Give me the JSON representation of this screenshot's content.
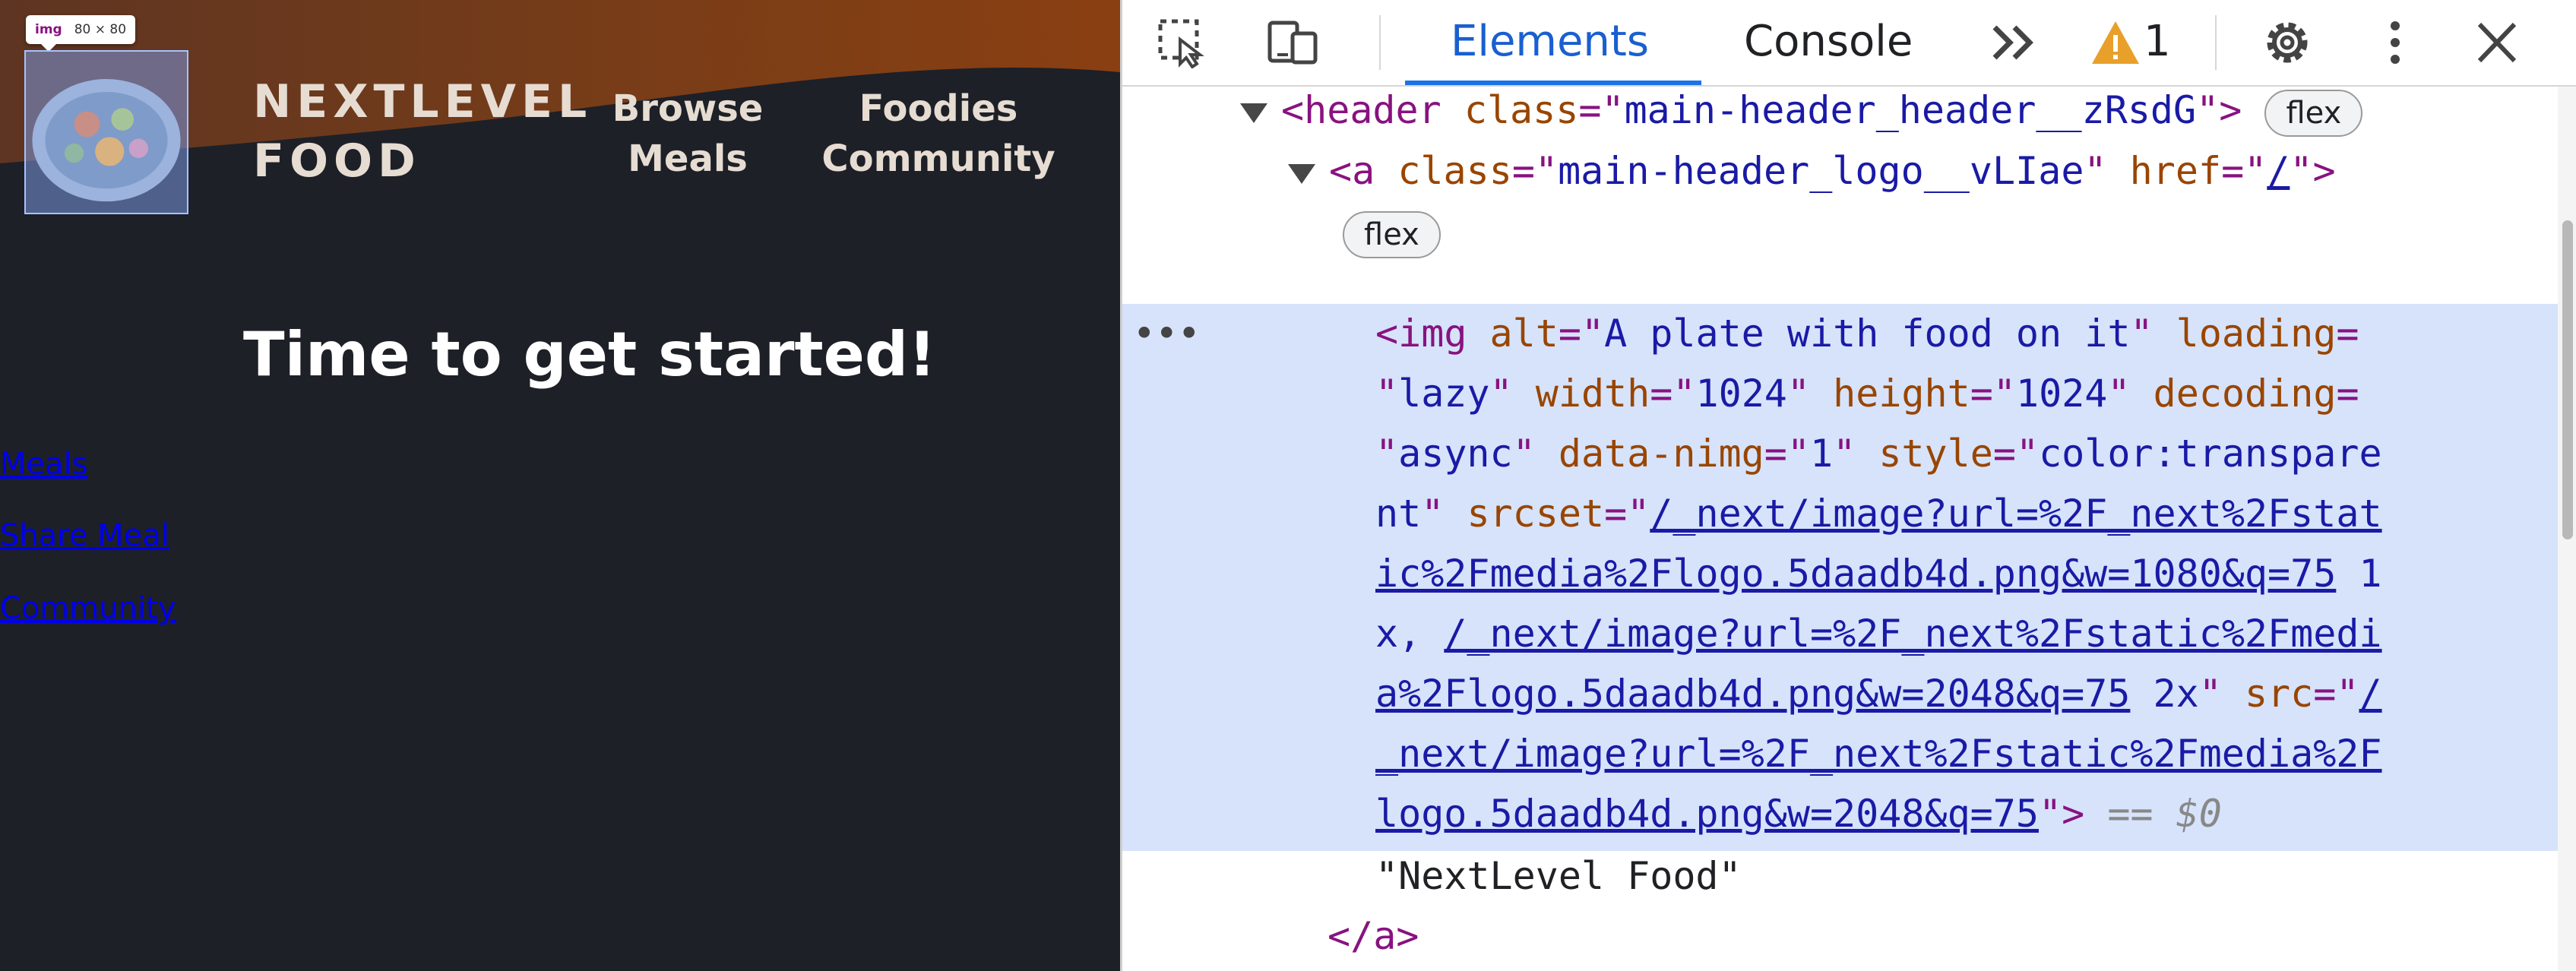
{
  "page": {
    "tooltip": {
      "tag": "img",
      "size": "80 × 80"
    },
    "logo_alt": "A plate with food on it",
    "brand_line1": "NEXTLEVEL",
    "brand_line2": "FOOD",
    "nav": {
      "meals": "Browse Meals",
      "community": "Foodies Community"
    },
    "heading": "Time to get started!",
    "side_links": {
      "meals": "Meals",
      "share": "Share Meal",
      "community": "Community"
    },
    "colors": {
      "background": "#1d2027",
      "header_gradient_start": "#6b3a1c",
      "header_gradient_end": "#8a3f12",
      "nav_text": "#e6dcd2"
    }
  },
  "devtools": {
    "tabs": {
      "elements": "Elements",
      "console": "Console"
    },
    "warnings": "1",
    "icons": [
      "inspect-element-icon",
      "device-toolbar-icon",
      "more-tabs-icon",
      "warning-icon",
      "settings-icon",
      "more-options-icon",
      "close-icon"
    ],
    "dom": {
      "header_tag": "header",
      "header_class_attr": "class",
      "header_class": "main-header_header__zRsdG",
      "header_badge": "flex",
      "a_tag": "a",
      "a_class_attr": "class",
      "a_class": "main-header_logo__vLIae",
      "a_href_attr": "href",
      "a_href": "/",
      "a_badge": "flex",
      "img": {
        "tag": "img",
        "alt_attr": "alt",
        "alt": "A plate with food on it",
        "loading_attr": "loading",
        "loading": "lazy",
        "width_attr": "width",
        "width": "1024",
        "height_attr": "height",
        "height": "1024",
        "decoding_attr": "decoding",
        "decoding": "async",
        "nimg_attr": "data-nimg",
        "nimg": "1",
        "style_attr": "style",
        "style_a": "color:transpare",
        "style_b": "nt",
        "srcset_attr": "srcset",
        "src1_a": "/_next/image?url=%2F_next%2Fstat",
        "src1_b": "ic%2Fmedia%2Flogo.5daadb4d.png&w=1080&q=75",
        "d1x_a": "1",
        "d1x_b": "x,",
        "src2_a": "/_next/image?url=%2F_next%2Fstatic%2Fmedi",
        "src2_b": "a%2Flogo.5daadb4d.png&w=2048&q=75",
        "d2x": "2x",
        "src_attr": "src",
        "src_a": "/",
        "src_b": "_next/image?url=%2F_next%2Fstatic%2Fmedia%2F",
        "src_c": "logo.5daadb4d.png&w=2048&q=75",
        "eq0": "== $0"
      },
      "text_node": "\"NextLevel Food\"",
      "close_a": "</a>"
    }
  }
}
